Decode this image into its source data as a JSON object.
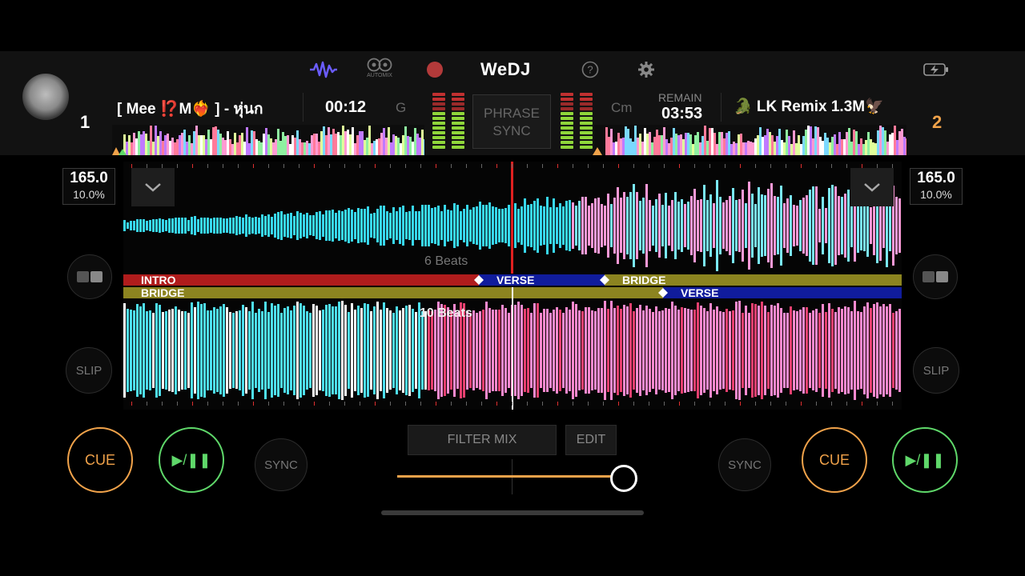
{
  "app": {
    "logo": "WeDJ"
  },
  "toolbar": {
    "icons": [
      "waveform-icon",
      "automix-icon",
      "record-icon",
      "help-icon",
      "settings-icon",
      "battery-icon"
    ],
    "automix_label": "AUTOMIX"
  },
  "deck1": {
    "number": "1",
    "title": "[ Mee ⁉️M❤️‍🔥 ] - หุ่นก",
    "time": "00:12",
    "key": "G",
    "bpm": "165.0",
    "pitch": "10.0%",
    "slip": "SLIP",
    "sync": "SYNC",
    "cue": "CUE",
    "play": "▶/❚❚"
  },
  "deck2": {
    "number": "2",
    "key": "Cm",
    "remain_label": "REMAIN",
    "remain": "03:53",
    "title": "🐊 LK Remix 1.3M🦅",
    "bpm": "165.0",
    "pitch": "10.0%",
    "slip": "SLIP",
    "sync": "SYNC",
    "cue": "CUE",
    "play": "▶/❚❚"
  },
  "phrase_sync": {
    "line1": "PHRASE",
    "line2": "SYNC"
  },
  "waveform": {
    "beats_top": "6 Beats",
    "beats_bottom": "10 Beats",
    "phrases_top": [
      {
        "label": "INTRO",
        "color": "#b01c1c"
      },
      {
        "label": "VERSE",
        "color": "#101c9c"
      },
      {
        "label": "BRIDGE",
        "color": "#8c8420"
      }
    ],
    "phrases_bottom": [
      {
        "label": "BRIDGE",
        "color": "#8c8420"
      },
      {
        "label": "VERSE",
        "color": "#101c9c"
      }
    ]
  },
  "fx": {
    "mode": "FILTER MIX",
    "edit": "EDIT",
    "level": 0.92
  },
  "colors": {
    "cue": "#f0a24a",
    "play": "#5fd86a",
    "deck2_num": "#f0a24a",
    "playhead": "#e02020",
    "accent": "#6a5cff"
  }
}
